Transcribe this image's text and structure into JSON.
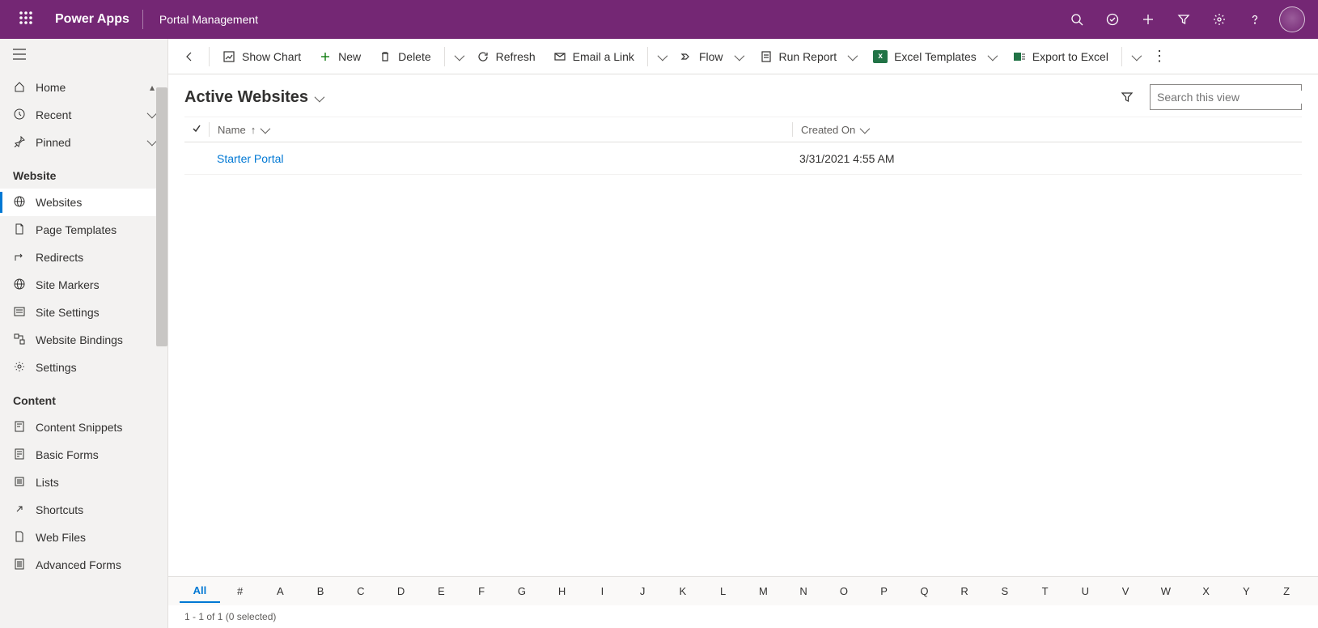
{
  "topbar": {
    "brand": "Power Apps",
    "appname": "Portal Management"
  },
  "sidebar": {
    "home": "Home",
    "recent": "Recent",
    "pinned": "Pinned",
    "group_website": "Website",
    "group_content": "Content",
    "website_items": [
      "Websites",
      "Page Templates",
      "Redirects",
      "Site Markers",
      "Site Settings",
      "Website Bindings",
      "Settings"
    ],
    "content_items": [
      "Content Snippets",
      "Basic Forms",
      "Lists",
      "Shortcuts",
      "Web Files",
      "Advanced Forms"
    ]
  },
  "commands": {
    "show_chart": "Show Chart",
    "new": "New",
    "delete": "Delete",
    "refresh": "Refresh",
    "email_link": "Email a Link",
    "flow": "Flow",
    "run_report": "Run Report",
    "excel_templates": "Excel Templates",
    "export_excel": "Export to Excel"
  },
  "view": {
    "title": "Active Websites",
    "search_placeholder": "Search this view"
  },
  "grid": {
    "col_name": "Name",
    "col_created": "Created On",
    "rows": [
      {
        "name": "Starter Portal",
        "created": "3/31/2021 4:55 AM"
      }
    ]
  },
  "alpha": [
    "All",
    "#",
    "A",
    "B",
    "C",
    "D",
    "E",
    "F",
    "G",
    "H",
    "I",
    "J",
    "K",
    "L",
    "M",
    "N",
    "O",
    "P",
    "Q",
    "R",
    "S",
    "T",
    "U",
    "V",
    "W",
    "X",
    "Y",
    "Z"
  ],
  "status": "1 - 1 of 1 (0 selected)"
}
